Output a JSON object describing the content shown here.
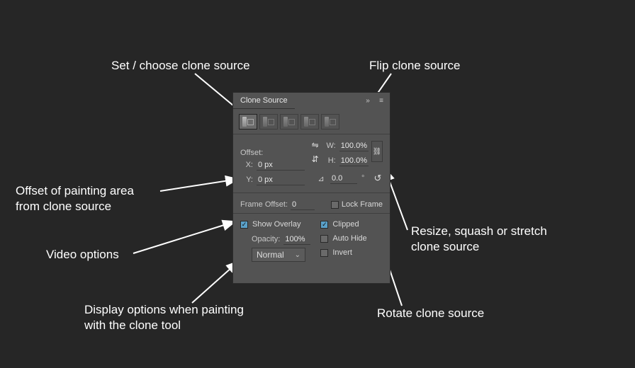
{
  "annotations": {
    "set_source": "Set / choose clone source",
    "flip": "Flip clone source",
    "offset1": "Offset of painting area",
    "offset2": "from clone source",
    "video": "Video options",
    "display1": "Display options when painting",
    "display2": "with the clone tool",
    "resize1": "Resize, squash or stretch",
    "resize2": "clone source",
    "rotate": "Rotate clone source"
  },
  "panel": {
    "title": "Clone Source",
    "offset_label": "Offset:",
    "x_label": "X:",
    "x_value": "0 px",
    "y_label": "Y:",
    "y_value": "0 px",
    "w_label": "W:",
    "w_value": "100.0%",
    "h_label": "H:",
    "h_value": "100.0%",
    "angle_value": "0.0",
    "angle_unit": "°",
    "frame_offset_label": "Frame Offset:",
    "frame_offset_value": "0",
    "lock_frame": "Lock Frame",
    "show_overlay": "Show Overlay",
    "opacity_label": "Opacity:",
    "opacity_value": "100%",
    "blend_mode": "Normal",
    "clipped": "Clipped",
    "auto_hide": "Auto Hide",
    "invert": "Invert"
  }
}
